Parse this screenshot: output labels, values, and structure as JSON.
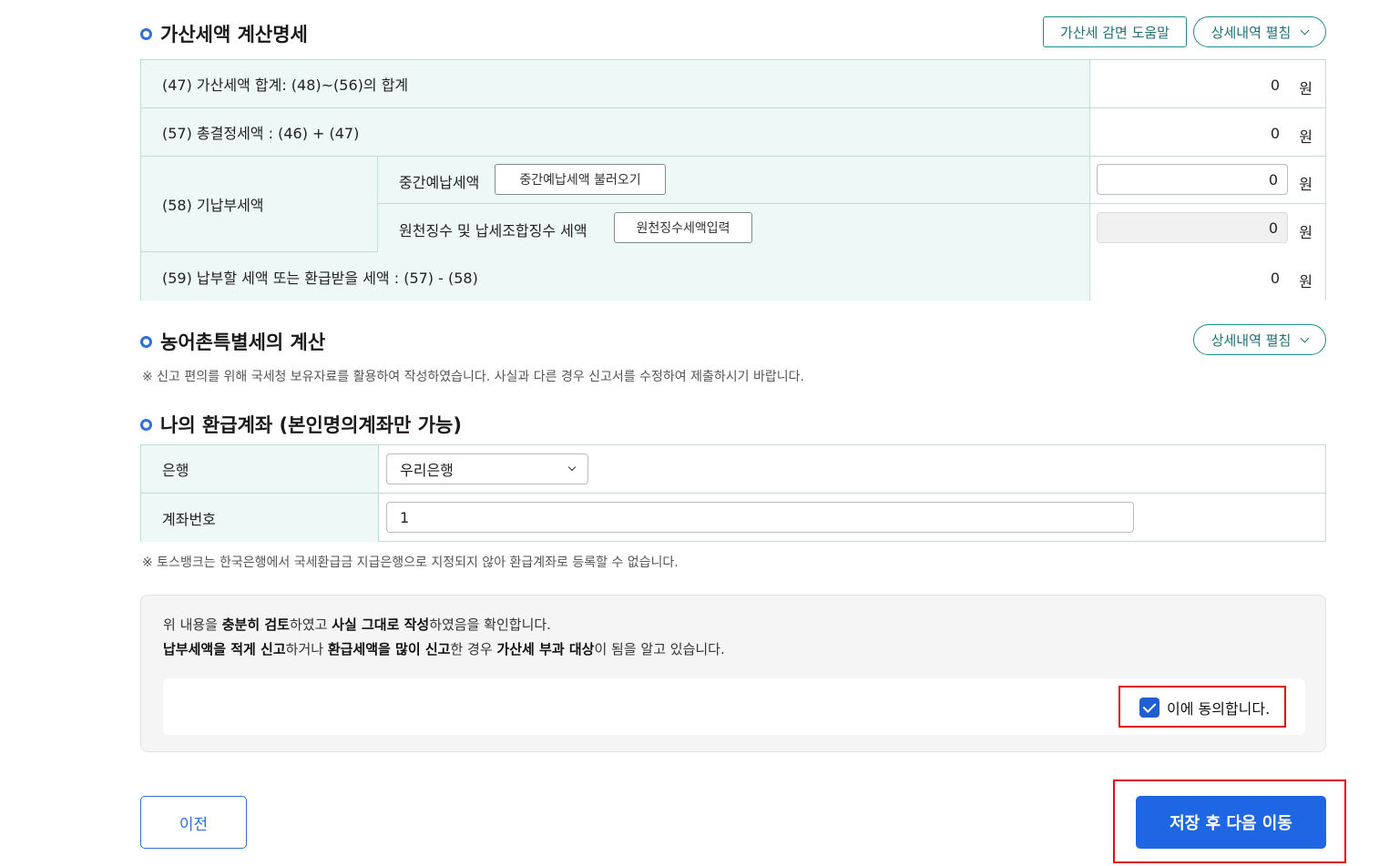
{
  "penalty_section": {
    "title": "가산세액 계산명세",
    "help_button": "가산세 감면 도움말",
    "expand_button": "상세내역 펼침",
    "rows": {
      "r47_label": "(47) 가산세액 합계: (48)~(56)의 합계",
      "r47_amount": "0",
      "r57_label": "(57) 총결정세액 : (46) + (47)",
      "r57_amount": "0",
      "r58_label": "(58) 기납부세액",
      "r58_sub1_label": "중간예납세액",
      "r58_sub1_button": "중간예납세액 불러오기",
      "r58_sub1_value": "0",
      "r58_sub2_label": "원천징수 및 납세조합징수 세액",
      "r58_sub2_button": "원천징수세액입력",
      "r58_sub2_value": "0",
      "r59_label": "(59) 납부할 세액 또는 환급받을 세액 : (57) - (58)",
      "r59_amount": "0"
    },
    "unit": "원"
  },
  "rural_section": {
    "title": "농어촌특별세의 계산",
    "expand_button": "상세내역 펼침",
    "note": "※ 신고 편의를 위해 국세청 보유자료를 활용하여 작성하였습니다. 사실과 다른 경우 신고서를 수정하여 제출하시기 바랍니다."
  },
  "refund_section": {
    "title": "나의 환급계좌 (본인명의계좌만 가능)",
    "bank_label": "은행",
    "bank_value": "우리은행",
    "account_label": "계좌번호",
    "account_value": "1",
    "note": "※ 토스뱅크는 한국은행에서 국세환급금 지급은행으로 지정되지 않아 환급계좌로 등록할 수 없습니다."
  },
  "consent": {
    "line1": {
      "p1": "위 내용을 ",
      "b1": "충분히 검토",
      "p2": "하였고 ",
      "b2": "사실 그대로 작성",
      "p3": "하였음을 확인합니다."
    },
    "line2": {
      "b1": "납부세액을 적게 신고",
      "p1": "하거나 ",
      "b2": "환급세액을 많이 신고",
      "p2": "한 경우 ",
      "b3": "가산세 부과 대상",
      "p3": "이 됨을 알고 있습니다."
    },
    "agree_label": "이에 동의합니다.",
    "agree_checked": true
  },
  "nav": {
    "prev_label": "이전",
    "next_label": "저장 후 다음 이동"
  },
  "colors": {
    "accent": "#1f66e5",
    "table_label_bg": "#eef8f7",
    "teal": "#1f8b8b",
    "highlight": "#e01010"
  }
}
